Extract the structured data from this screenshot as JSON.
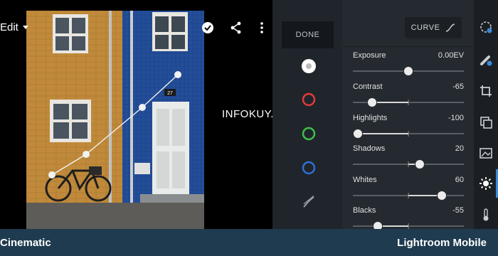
{
  "toolbar": {
    "edit_label": "Edit",
    "icons": [
      "check-circle-icon",
      "share-icon",
      "more-vertical-icon"
    ]
  },
  "watermark": "INFOKUY.NET",
  "photo_house_number": "27",
  "tools": {
    "done_label": "DONE",
    "channels": [
      {
        "name": "white-channel-icon",
        "color": "#ffffff"
      },
      {
        "name": "red-channel-icon",
        "color": "#e23a3a"
      },
      {
        "name": "green-channel-icon",
        "color": "#3ec14a"
      },
      {
        "name": "blue-channel-icon",
        "color": "#2f6fd6"
      },
      {
        "name": "point-curve-icon",
        "color": "#9aa0a6"
      }
    ]
  },
  "panel": {
    "curve_label": "CURVE",
    "sliders": [
      {
        "label": "Exposure",
        "value": "0.00EV",
        "level": 0.0
      },
      {
        "label": "Contrast",
        "value": "-65",
        "level": -0.65
      },
      {
        "label": "Highlights",
        "value": "-100",
        "level": -1.0
      },
      {
        "label": "Shadows",
        "value": "20",
        "level": 0.2
      },
      {
        "label": "Whites",
        "value": "60",
        "level": 0.6
      },
      {
        "label": "Blacks",
        "value": "-55",
        "level": -0.55
      }
    ]
  },
  "rail": {
    "icons": [
      "presets-icon",
      "auto-heal-icon",
      "crop-icon",
      "versions-icon",
      "selective-icon",
      "light-icon",
      "temperature-icon"
    ],
    "active": "light-icon"
  },
  "bottom": {
    "left_caption": "Cinematic",
    "right_caption": "Lightroom Mobile"
  },
  "colors": {
    "panel_bg": "#252a30",
    "tools_bg": "#20252b",
    "bottom_bar": "#1f3b50",
    "accent": "#3c8ad8"
  }
}
